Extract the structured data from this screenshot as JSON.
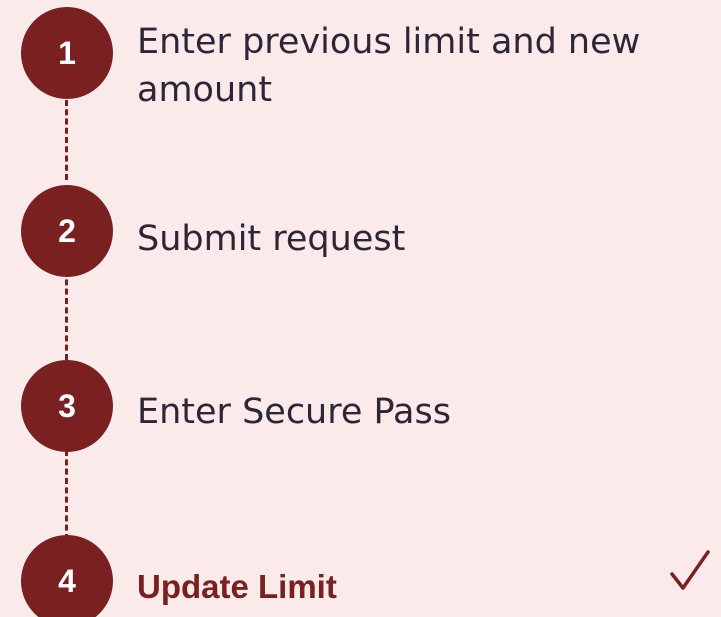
{
  "steps": [
    {
      "number": "1",
      "label": "Enter previous limit and new amount"
    },
    {
      "number": "2",
      "label": "Submit request"
    },
    {
      "number": "3",
      "label": "Enter Secure Pass"
    },
    {
      "number": "4",
      "label": "Update Limit"
    }
  ],
  "current_step_index": 4,
  "icons": {
    "complete": "checkmark-icon"
  },
  "colors": {
    "accent": "#7a2020",
    "background": "#fbeaea",
    "text": "#2d2638"
  }
}
